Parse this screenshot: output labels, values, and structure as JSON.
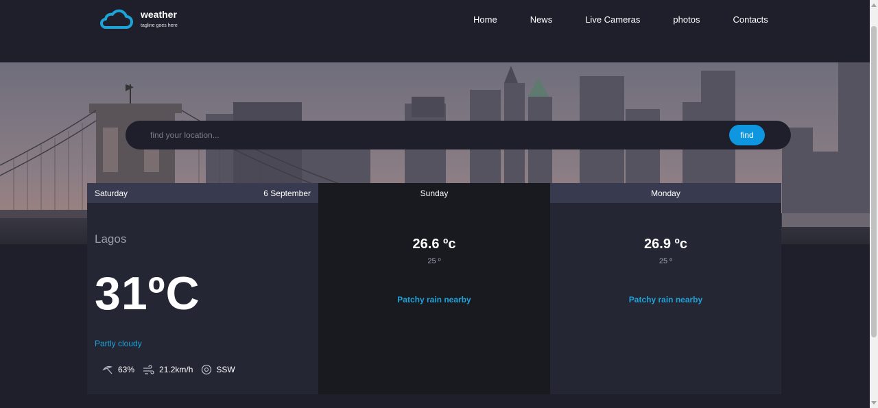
{
  "brand": {
    "title": "weather",
    "tagline": "tagline goes here",
    "accent": "#1ea3d9"
  },
  "nav": {
    "items": [
      "Home",
      "News",
      "Live Cameras",
      "photos",
      "Contacts"
    ]
  },
  "search": {
    "placeholder": "find your location...",
    "button_label": "find"
  },
  "today": {
    "day": "Saturday",
    "date": "6 September",
    "location": "Lagos",
    "temp": "31ºC",
    "condition": "Partly cloudy",
    "humidity": "63%",
    "wind_speed": "21.2km/h",
    "wind_dir": "SSW"
  },
  "forecast": [
    {
      "day": "Sunday",
      "temp": "26.6 ºc",
      "min": "25 º",
      "condition": "Patchy rain nearby"
    },
    {
      "day": "Monday",
      "temp": "26.9 ºc",
      "min": "25 º",
      "condition": "Patchy rain nearby"
    }
  ],
  "icons": [
    "cloud-logo-icon",
    "umbrella-icon",
    "wind-icon",
    "compass-icon"
  ]
}
